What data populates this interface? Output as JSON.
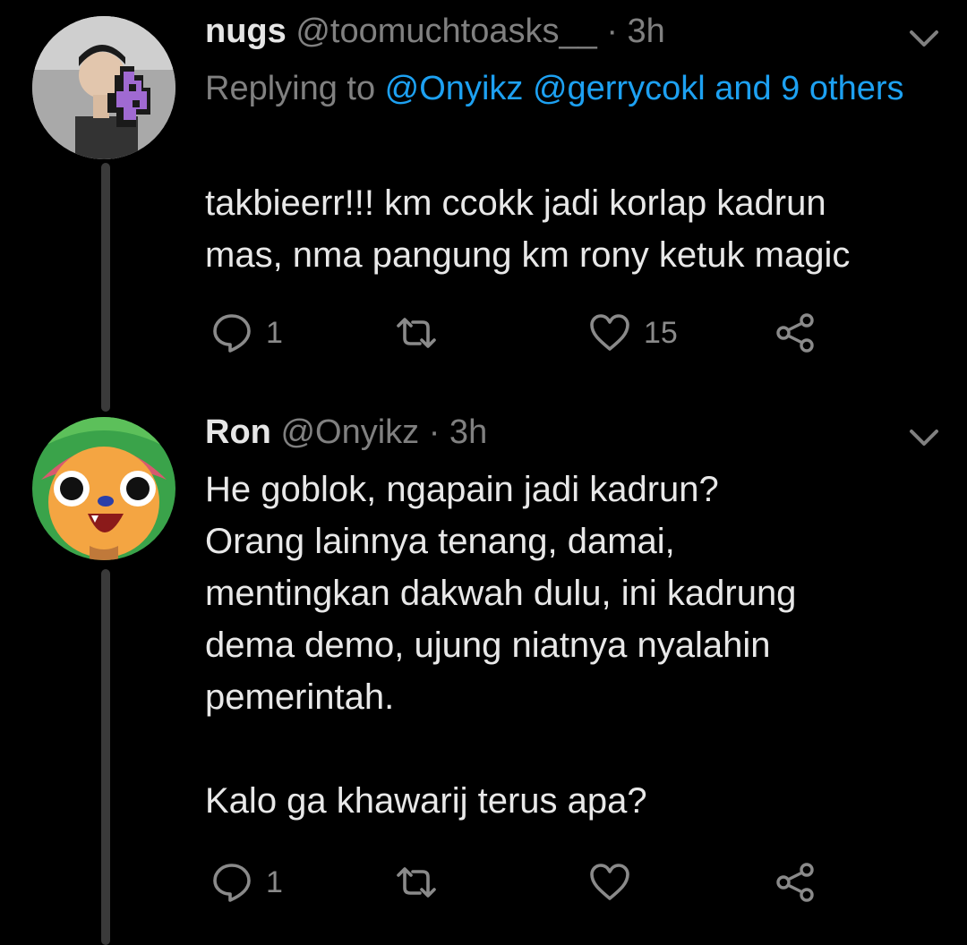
{
  "tweets": [
    {
      "name": "nugs",
      "handle": "@toomuchtoasks__",
      "time": "· 3h",
      "replying_prefix": "Replying to ",
      "replying_mentions": "@Onyikz @gerrycokl and 9 others",
      "body": "takbieerr!!! km ccokk jadi korlap kadrun\nmas, nma pangung km rony ketuk magic",
      "reply_count": "1",
      "retweet_count": "",
      "like_count": "15"
    },
    {
      "name": "Ron",
      "handle": "@Onyikz",
      "time": "· 3h",
      "body": "He goblok, ngapain jadi kadrun?\nOrang lainnya tenang, damai,\nmentingkan dakwah dulu, ini kadrung\ndema demo, ujung niatnya nyalahin\npemerintah.\n\nKalo ga khawarij terus apa?",
      "reply_count": "1",
      "retweet_count": "",
      "like_count": ""
    }
  ],
  "icons": {
    "reply": "speech-bubble-icon",
    "retweet": "retweet-icon",
    "like": "heart-icon",
    "share": "share-icon",
    "menu": "chevron-down-icon"
  },
  "colors": {
    "background": "#000000",
    "link": "#1da1f2",
    "muted": "#808080",
    "text": "#e8e8e8"
  }
}
